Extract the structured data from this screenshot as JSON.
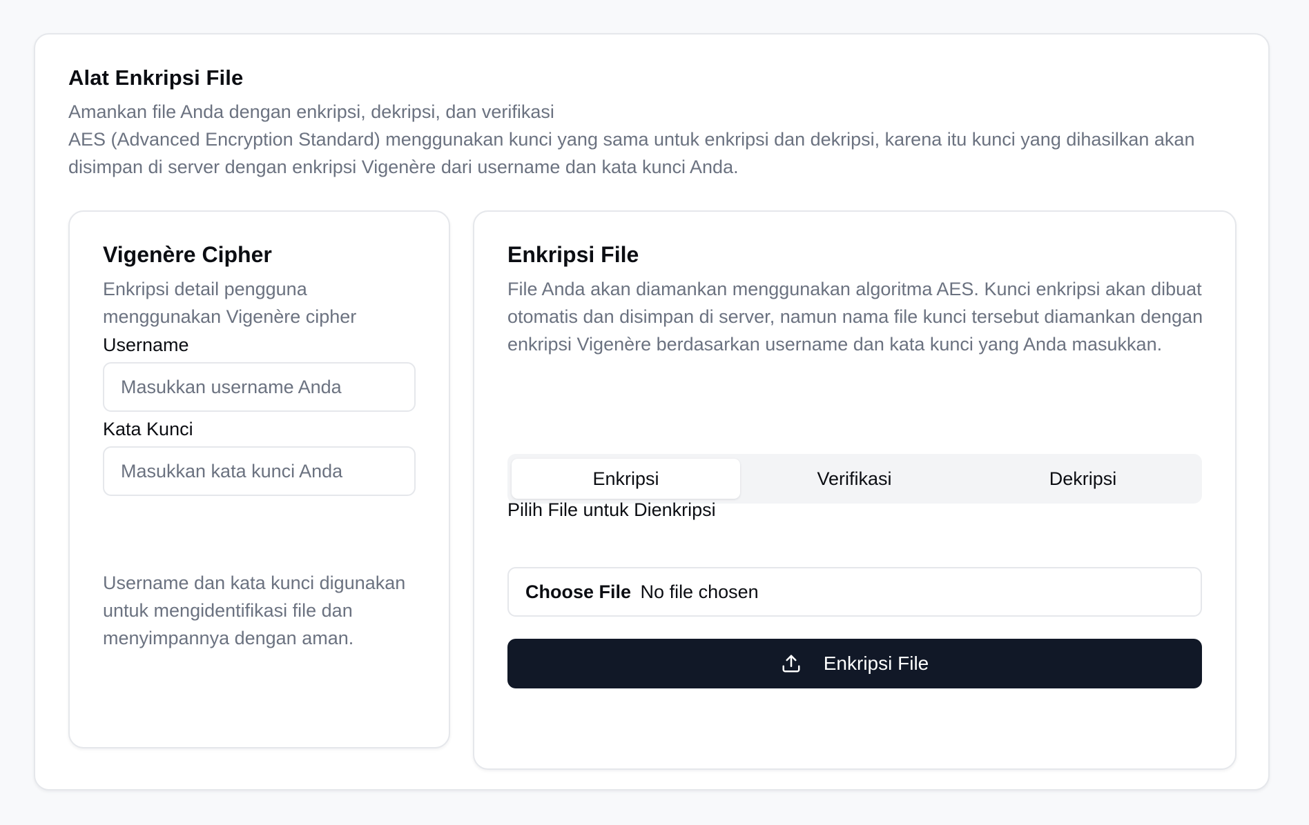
{
  "header": {
    "title": "Alat Enkripsi File",
    "subtitle": "Amankan file Anda dengan enkripsi, dekripsi, dan verifikasi",
    "description": "AES (Advanced Encryption Standard) menggunakan kunci yang sama untuk enkripsi dan dekripsi, karena itu kunci yang dihasilkan akan disimpan di server dengan enkripsi Vigenère dari username dan kata kunci Anda."
  },
  "vigenere": {
    "title": "Vigenère Cipher",
    "description": "Enkripsi detail pengguna menggunakan Vigenère cipher",
    "username_label": "Username",
    "username_placeholder": "Masukkan username Anda",
    "username_value": "",
    "password_label": "Kata Kunci",
    "password_placeholder": "Masukkan kata kunci Anda",
    "password_value": "",
    "note": "Username dan kata kunci digunakan untuk mengidentifikasi file dan menyimpannya dengan aman."
  },
  "encryption": {
    "title": "Enkripsi File",
    "description": "File Anda akan diamankan menggunakan algoritma AES. Kunci enkripsi akan dibuat otomatis dan disimpan di server, namun nama file kunci tersebut diamankan dengan enkripsi Vigenère berdasarkan username dan kata kunci yang Anda masukkan.",
    "tabs": [
      {
        "label": "Enkripsi",
        "active": true
      },
      {
        "label": "Verifikasi",
        "active": false
      },
      {
        "label": "Dekripsi",
        "active": false
      }
    ],
    "file_label": "Pilih File untuk Dienkripsi",
    "choose_file_label": "Choose File",
    "file_status": "No file chosen",
    "submit_label": "Enkripsi File",
    "submit_icon": "upload-icon"
  },
  "colors": {
    "page_background": "#f8f9fb",
    "card_background": "#ffffff",
    "border": "#e5e7eb",
    "muted_text": "#6b7280",
    "primary_button": "#111827",
    "tab_track": "#f3f4f6"
  }
}
